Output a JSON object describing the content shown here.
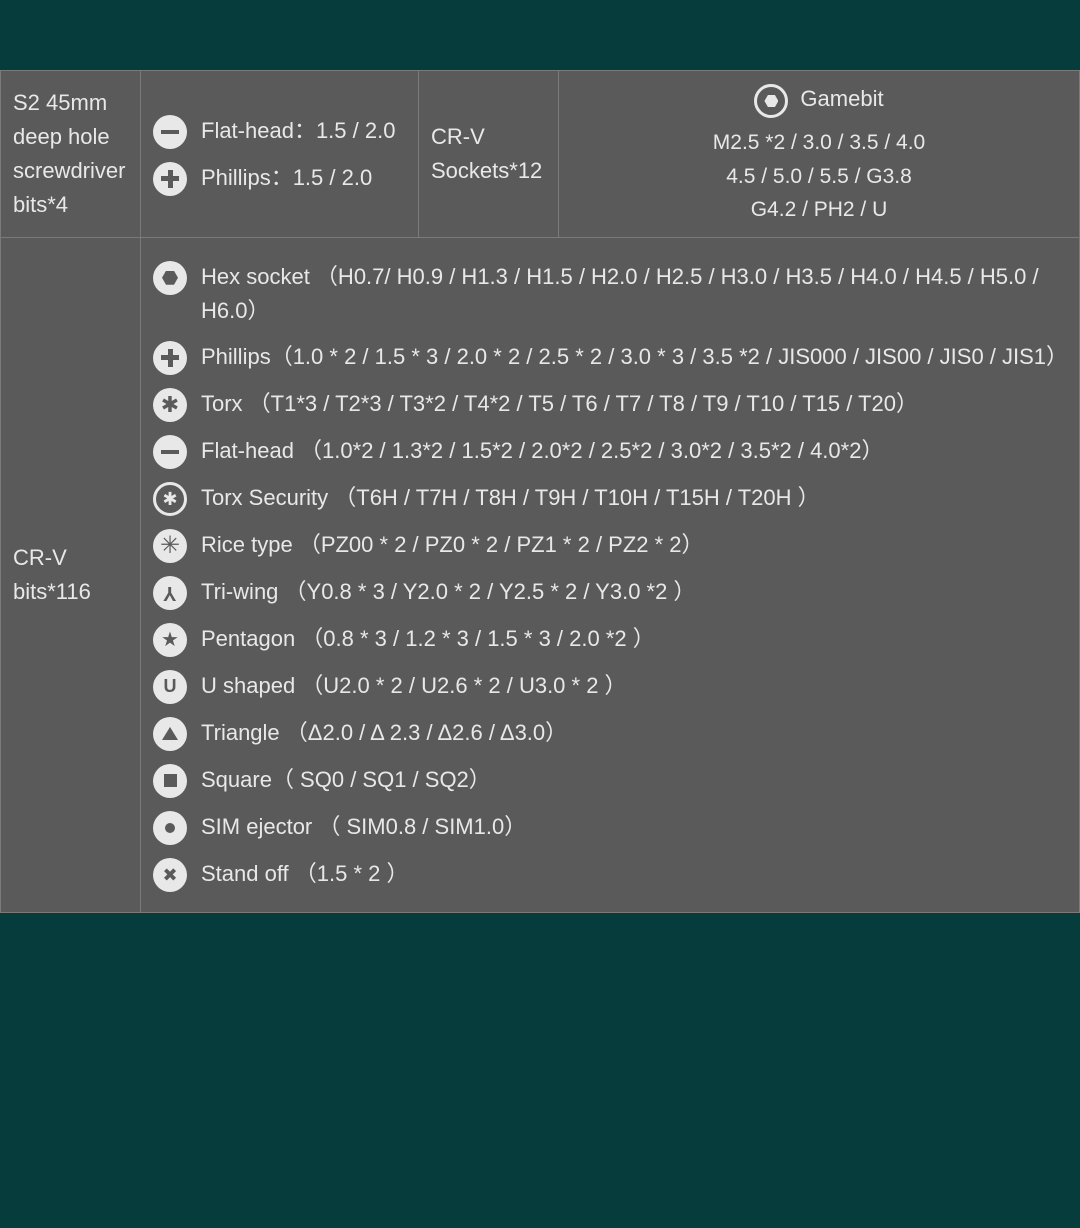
{
  "row1": {
    "label": "S2 45mm deep hole screwdriver bits*4",
    "flathead": "Flat-head：1.5 / 2.0",
    "phillips": "Phillips：1.5 / 2.0",
    "sockets_label": "CR-V Sockets*12",
    "gamebit_title": "Gamebit",
    "gamebit_line1": "M2.5 *2 / 3.0 / 3.5 / 4.0",
    "gamebit_line2": "4.5 / 5.0 / 5.5 / G3.8",
    "gamebit_line3": "G4.2 / PH2 / U"
  },
  "row2": {
    "label": "CR-V bits*116",
    "items": {
      "hex": "Hex socket （H0.7/ H0.9 / H1.3 / H1.5 / H2.0 / H2.5 / H3.0 / H3.5 / H4.0 / H4.5 / H5.0 / H6.0）",
      "phillips": "Phillips（1.0 * 2 / 1.5 * 3 / 2.0 * 2 / 2.5 * 2 / 3.0 * 3 / 3.5 *2  / JIS000  / JIS00 / JIS0 / JIS1）",
      "torx": "Torx  （T1*3 / T2*3 / T3*2 / T4*2 / T5 / T6 / T7 / T8 / T9 / T10 / T15 / T20）",
      "flat": "Flat-head （1.0*2 / 1.3*2 / 1.5*2 / 2.0*2 / 2.5*2 / 3.0*2 / 3.5*2  / 4.0*2）",
      "torxsec": "Torx Security  （T6H / T7H / T8H / T9H / T10H / T15H / T20H ）",
      "rice": "Rice type  （PZ00 * 2 / PZ0 * 2 / PZ1 * 2 / PZ2 * 2）",
      "triwing": "Tri-wing （Y0.8 * 3 / Y2.0 * 2 / Y2.5 * 2 / Y3.0 *2 ）",
      "pentagon": "Pentagon  （0.8 * 3 / 1.2 * 3 / 1.5 * 3 / 2.0 *2 ）",
      "ushaped": "U shaped  （U2.0 * 2 / U2.6 * 2 / U3.0 * 2 ）",
      "triangle": "Triangle  （Δ2.0 / Δ 2.3 / Δ2.6 / Δ3.0）",
      "square": "Square（ SQ0 / SQ1 / SQ2）",
      "sim": "SIM ejector （ SIM0.8  / SIM1.0）",
      "standoff": "Stand off  （1.5 * 2 ）"
    }
  }
}
